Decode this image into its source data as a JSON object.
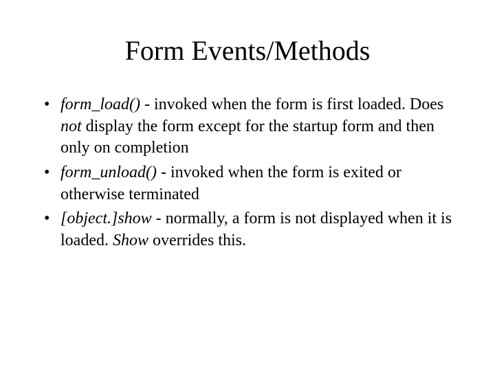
{
  "title": "Form Events/Methods",
  "bullets": [
    {
      "term": "form_load()",
      "sep": " - ",
      "pre": "invoked when the form is first loaded.  Does ",
      "em": "not",
      "post": " display the form except for the startup form and then only on completion"
    },
    {
      "term": "form_unload()",
      "sep": " - ",
      "pre": "invoked when the form is exited or otherwise terminated",
      "em": "",
      "post": ""
    },
    {
      "term": "[object.]show",
      "sep": " - ",
      "pre": "normally, a form is not displayed when it is loaded.  ",
      "em": "Show",
      "post": " overrides this."
    }
  ]
}
